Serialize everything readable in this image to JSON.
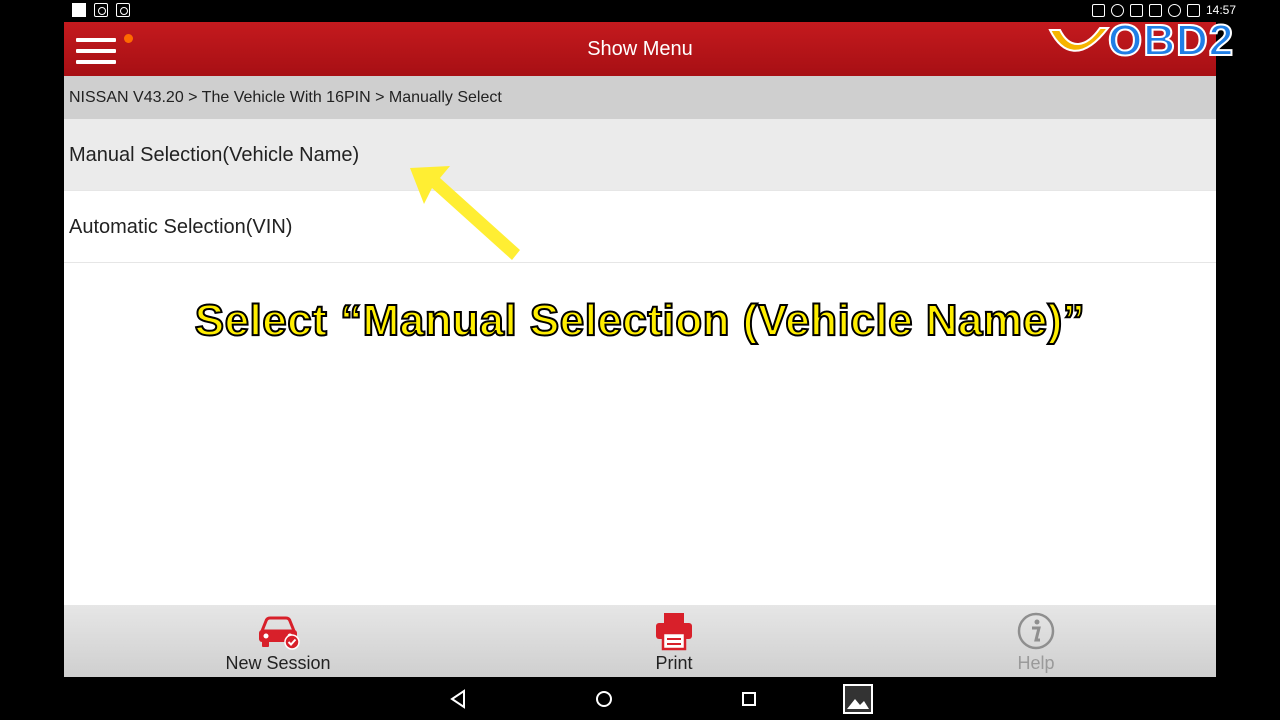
{
  "status_bar": {
    "time": "14:57"
  },
  "topbar": {
    "title": "Show Menu"
  },
  "logo": {
    "text": "OBD2"
  },
  "breadcrumb": {
    "text": "NISSAN V43.20 > The Vehicle With 16PIN > Manually Select"
  },
  "menu_items": [
    {
      "label": "Manual Selection(Vehicle Name)"
    },
    {
      "label": "Automatic Selection(VIN)"
    }
  ],
  "caption": {
    "text": "Select “Manual Selection (Vehicle Name)”"
  },
  "bottom_bar": {
    "new_session": "New Session",
    "print": "Print",
    "help": "Help"
  },
  "colors": {
    "topbar": "#b5151a",
    "accent_red": "#d8202a",
    "caption_yellow": "#ffee00",
    "logo_blue": "#1f7ee6"
  },
  "icons": {
    "menu": "hamburger-menu-icon",
    "new_session": "car-check-icon",
    "print": "printer-icon",
    "help": "info-icon",
    "nav_back": "back-triangle-icon",
    "nav_home": "home-circle-icon",
    "nav_recent": "recent-square-icon",
    "nav_screenshot": "gallery-icon"
  }
}
